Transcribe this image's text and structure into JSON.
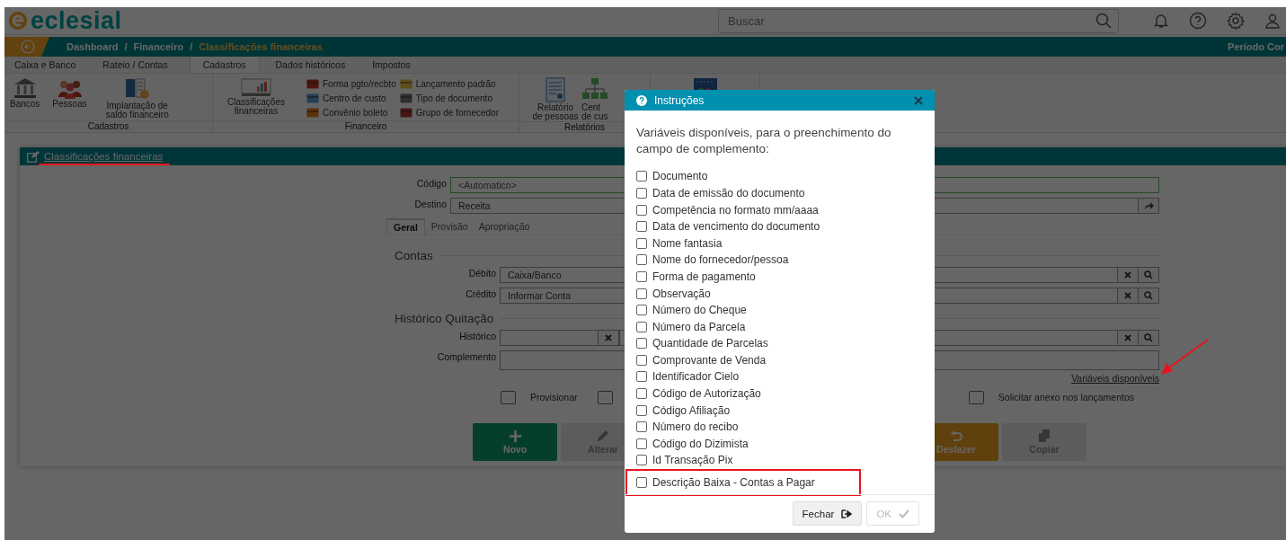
{
  "brand": "eclesial",
  "search": {
    "placeholder": "Buscar"
  },
  "breadcrumb": {
    "separator": "/",
    "items": [
      {
        "label": "Dashboard",
        "current": false
      },
      {
        "label": "Financeiro",
        "current": false
      },
      {
        "label": "Classificações financeiras",
        "current": true
      }
    ]
  },
  "period": "Período Cor",
  "menu_tabs": [
    {
      "label": "Caixa e Banco",
      "selected": false
    },
    {
      "label": "Rateio / Contas",
      "selected": false
    },
    {
      "label": "Cadastros",
      "selected": true
    },
    {
      "label": "Dados históricos",
      "selected": false
    },
    {
      "label": "Impostos",
      "selected": false
    }
  ],
  "ribbon": {
    "groups": [
      {
        "title": "Cadastros",
        "items": [
          {
            "kind": "large",
            "label": "Bancos"
          },
          {
            "kind": "large",
            "label": "Pessoas"
          },
          {
            "kind": "large",
            "label": "Implantação de saldo financeiro"
          }
        ]
      },
      {
        "title": "Financeiro",
        "items": [
          {
            "kind": "large",
            "label": "Classificações financeiras"
          },
          {
            "kind": "small",
            "label": "Forma pgto/recbto"
          },
          {
            "kind": "small",
            "label": "Centro de custo"
          },
          {
            "kind": "small",
            "label": "Convênio boleto"
          },
          {
            "kind": "small",
            "label": "Lançamento padrão"
          },
          {
            "kind": "small",
            "label": "Tipo de documento"
          },
          {
            "kind": "small",
            "label": "Grupo de fornecedor"
          }
        ]
      },
      {
        "title": "Relatórios",
        "items": [
          {
            "kind": "large",
            "label": "Relatório de pessoas"
          },
          {
            "kind": "large",
            "label": "Cent de cus"
          }
        ]
      },
      {
        "items": [
          {
            "kind": "large"
          }
        ]
      }
    ]
  },
  "panel": {
    "title": "Classificações financeiras",
    "marked": true
  },
  "form": {
    "fields": [
      {
        "label": "Código",
        "kind": "code",
        "value": "<Automatico>"
      },
      {
        "label": "Destino",
        "kind": "select",
        "value": "Receita"
      }
    ],
    "tabs": [
      {
        "label": "Geral",
        "selected": true
      },
      {
        "label": "Provisão",
        "selected": false
      },
      {
        "label": "Apropriação",
        "selected": false
      }
    ],
    "sections": [
      {
        "title": "Contas",
        "fields": [
          {
            "label": "Débito",
            "kind": "lookup",
            "value": "Caixa/Banco"
          },
          {
            "label": "Crédito",
            "kind": "lookup",
            "value": "Informar Conta"
          }
        ]
      },
      {
        "title": "Histórico Quitação",
        "fields": [
          {
            "label": "Histórico",
            "kind": "split"
          },
          {
            "label": "Complemento",
            "kind": "textarea"
          }
        ]
      }
    ],
    "link": "Variáveis disponíveis",
    "options": [
      {
        "label": "Provisionar",
        "checked": false
      },
      {
        "checked": false
      },
      {
        "label": "Solicitar anexo nos lançamentos",
        "checked": false
      }
    ],
    "buttons": [
      {
        "label": "Novo",
        "kind": "add",
        "disabled": false
      },
      {
        "label": "Alterar",
        "kind": "edit",
        "disabled": true
      },
      {
        "label": "Desfazer",
        "kind": "undo",
        "disabled": false
      },
      {
        "label": "Copiar",
        "kind": "copy",
        "disabled": true
      }
    ]
  },
  "dialog": {
    "title": "Instruções",
    "intro": "Variáveis disponíveis, para o preenchimento do campo de complemento:",
    "variables": [
      {
        "label": "Documento",
        "checked": false,
        "highlighted": false
      },
      {
        "label": "Data de emissão do documento",
        "checked": false,
        "highlighted": false
      },
      {
        "label": "Competência no formato mm/aaaa",
        "checked": false,
        "highlighted": false
      },
      {
        "label": "Data de vencimento do documento",
        "checked": false,
        "highlighted": false
      },
      {
        "label": "Nome fantasia",
        "checked": false,
        "highlighted": false
      },
      {
        "label": "Nome do fornecedor/pessoa",
        "checked": false,
        "highlighted": false
      },
      {
        "label": "Forma de pagamento",
        "checked": false,
        "highlighted": false
      },
      {
        "label": "Observação",
        "checked": false,
        "highlighted": false
      },
      {
        "label": "Número do Cheque",
        "checked": false,
        "highlighted": false
      },
      {
        "label": "Número da Parcela",
        "checked": false,
        "highlighted": false
      },
      {
        "label": "Quantidade de Parcelas",
        "checked": false,
        "highlighted": false
      },
      {
        "label": "Comprovante de Venda",
        "checked": false,
        "highlighted": false
      },
      {
        "label": "Identificador Cielo",
        "checked": false,
        "highlighted": false
      },
      {
        "label": "Código de Autorização",
        "checked": false,
        "highlighted": false
      },
      {
        "label": "Código Afiliação",
        "checked": false,
        "highlighted": false
      },
      {
        "label": "Número do recibo",
        "checked": false,
        "highlighted": false
      },
      {
        "label": "Código do Dizimista",
        "checked": false,
        "highlighted": false
      },
      {
        "label": "Id Transação Pix",
        "checked": false,
        "highlighted": false
      },
      {
        "label": "Descrição Baixa - Contas a Pagar",
        "checked": false,
        "highlighted": true
      }
    ],
    "buttons": [
      {
        "label": "Fechar",
        "kind": "close",
        "disabled": false
      },
      {
        "label": "OK",
        "kind": "confirm",
        "disabled": true
      }
    ]
  }
}
